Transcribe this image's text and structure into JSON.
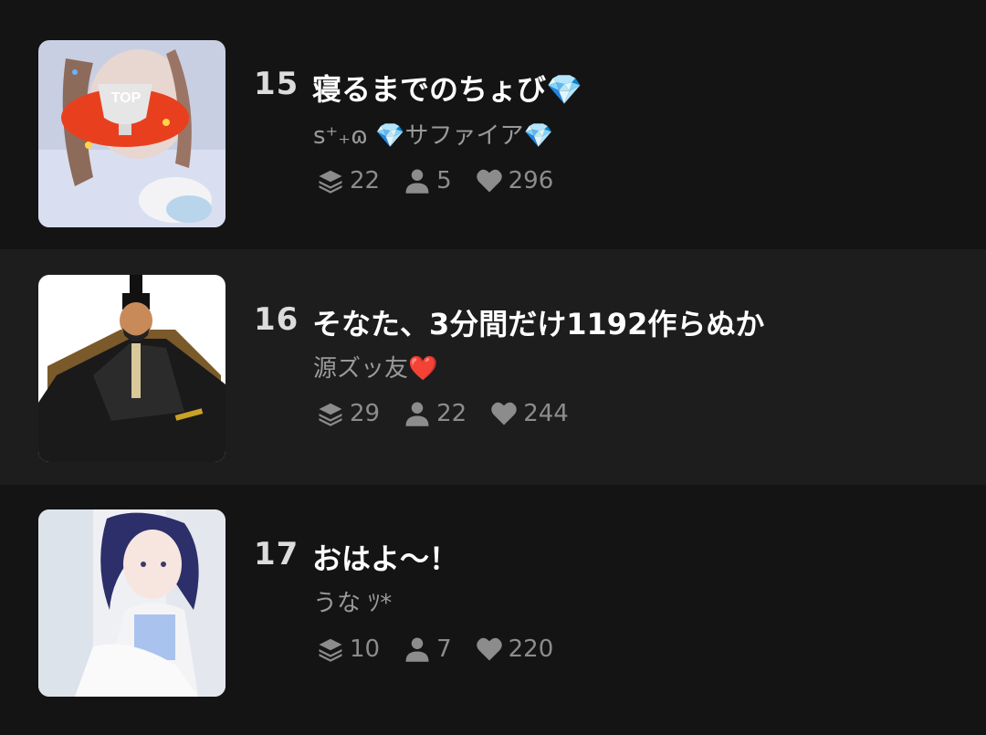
{
  "items": [
    {
      "rank": "15",
      "title": "寝るまでのちょび💎",
      "author": "s⁺₊ɷ 💎サファイア💎",
      "stats": {
        "chapters": "22",
        "users": "5",
        "likes": "296"
      },
      "badge": "TOP"
    },
    {
      "rank": "16",
      "title": "そなた、3分間だけ1192作らぬか",
      "author": "源ズッ友❤️",
      "stats": {
        "chapters": "29",
        "users": "22",
        "likes": "244"
      }
    },
    {
      "rank": "17",
      "title": "おはよ〜！",
      "author": "うな ﾂ*",
      "stats": {
        "chapters": "10",
        "users": "7",
        "likes": "220"
      }
    }
  ],
  "icons": {
    "chapters": "stack-icon",
    "users": "person-icon",
    "likes": "heart-icon"
  },
  "colors": {
    "background": "#141414",
    "alt_background": "#1d1d1d",
    "stat_text": "#8c8c8c"
  }
}
